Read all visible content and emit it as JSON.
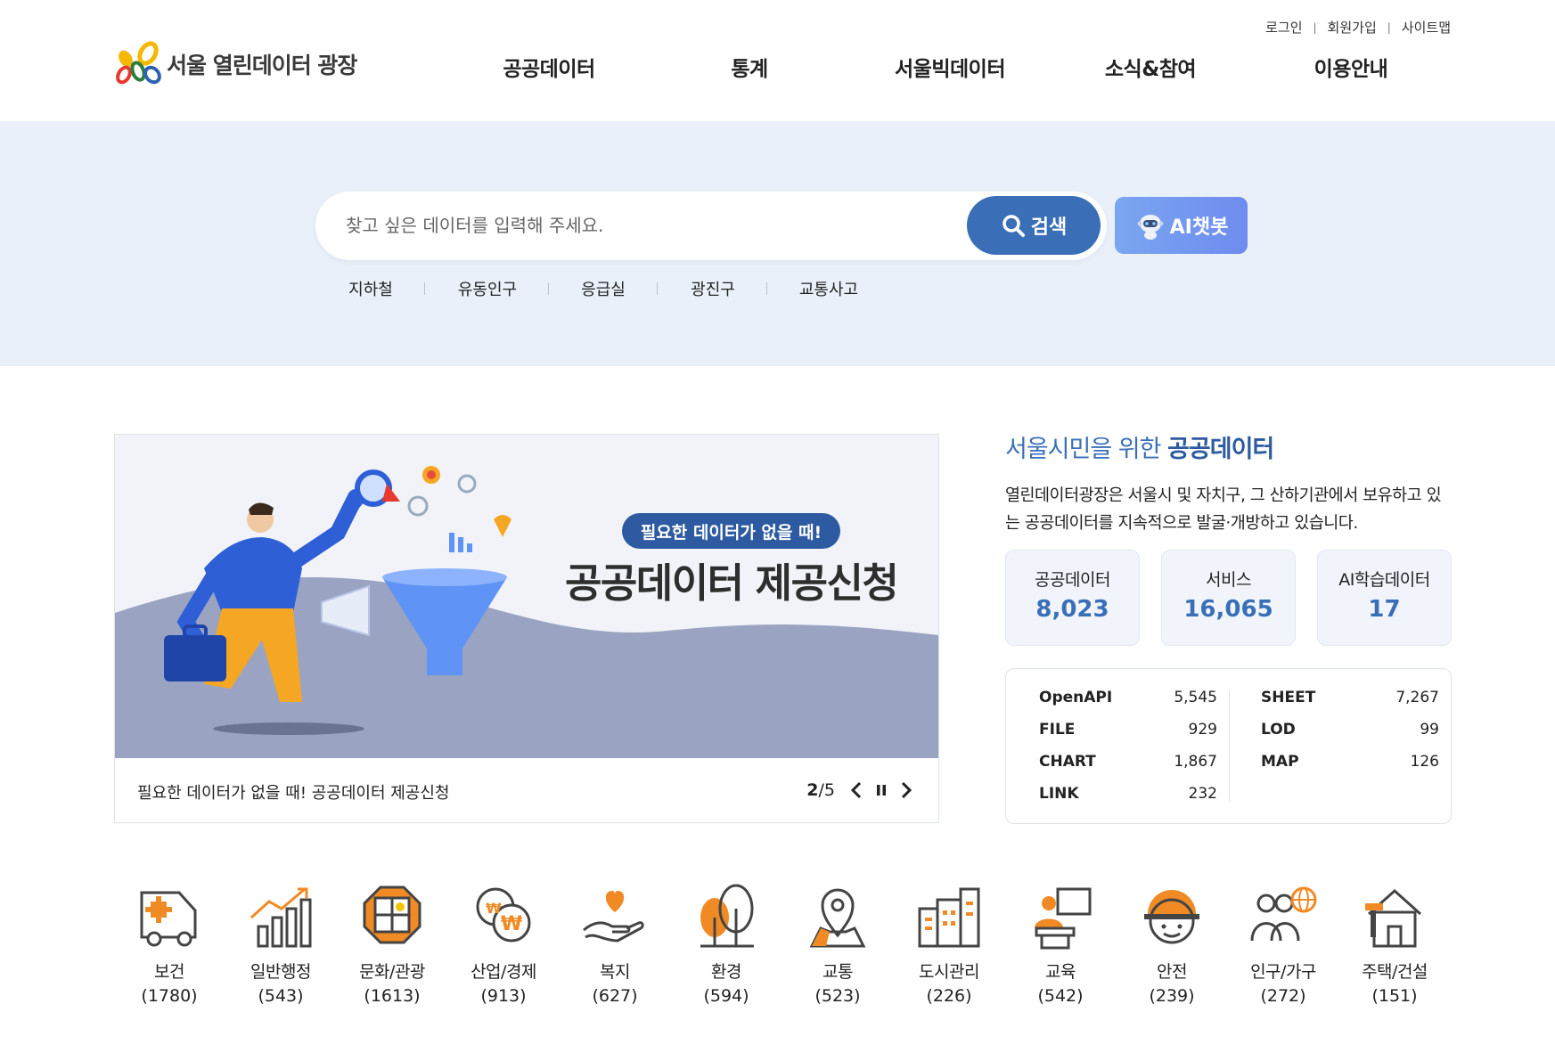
{
  "header": {
    "logo_text": "서울 열린데이터 광장",
    "util_links": [
      "로그인",
      "회원가입",
      "사이트맵"
    ],
    "nav": [
      "공공데이터",
      "통계",
      "서울빅데이터",
      "소식&참여",
      "이용안내"
    ]
  },
  "search": {
    "placeholder": "찾고 싶은 데이터를 입력해 주세요.",
    "button_label": "검색",
    "ai_button_label": "AI챗봇",
    "keywords": [
      "지하철",
      "유동인구",
      "응급실",
      "광진구",
      "교통사고"
    ]
  },
  "banner": {
    "badge": "필요한 데이터가 없을 때!",
    "title": "공공데이터 제공신청",
    "caption": "필요한 데이터가 없을 때! 공공데이터 제공신청",
    "page_current": "2",
    "page_total": "5"
  },
  "info": {
    "title_prefix": "서울시민을 위한 ",
    "title_strong": "공공데이터",
    "description": "열린데이터광장은 서울시 및 자치구, 그 산하기관에서 보유하고 있는 공공데이터를 지속적으로 발굴·개방하고 있습니다.",
    "stats": [
      {
        "label": "공공데이터",
        "value": "8,023"
      },
      {
        "label": "서비스",
        "value": "16,065"
      },
      {
        "label": "AI학습데이터",
        "value": "17"
      }
    ],
    "formats_left": [
      {
        "name": "OpenAPI",
        "value": "5,545"
      },
      {
        "name": "FILE",
        "value": "929"
      },
      {
        "name": "CHART",
        "value": "1,867"
      },
      {
        "name": "LINK",
        "value": "232"
      }
    ],
    "formats_right": [
      {
        "name": "SHEET",
        "value": "7,267"
      },
      {
        "name": "LOD",
        "value": "99"
      },
      {
        "name": "MAP",
        "value": "126"
      }
    ]
  },
  "categories": [
    {
      "name": "보건",
      "count": "(1780)",
      "icon": "ambulance-icon"
    },
    {
      "name": "일반행정",
      "count": "(543)",
      "icon": "bar-chart-icon"
    },
    {
      "name": "문화/관광",
      "count": "(1613)",
      "icon": "window-icon"
    },
    {
      "name": "산업/경제",
      "count": "(913)",
      "icon": "coins-icon"
    },
    {
      "name": "복지",
      "count": "(627)",
      "icon": "heart-hand-icon"
    },
    {
      "name": "환경",
      "count": "(594)",
      "icon": "trees-icon"
    },
    {
      "name": "교통",
      "count": "(523)",
      "icon": "map-pin-icon"
    },
    {
      "name": "도시관리",
      "count": "(226)",
      "icon": "buildings-icon"
    },
    {
      "name": "교육",
      "count": "(542)",
      "icon": "teacher-icon"
    },
    {
      "name": "안전",
      "count": "(239)",
      "icon": "helmet-icon"
    },
    {
      "name": "인구/가구",
      "count": "(272)",
      "icon": "people-globe-icon"
    },
    {
      "name": "주택/건설",
      "count": "(151)",
      "icon": "house-tools-icon"
    }
  ],
  "colors": {
    "accent": "#3a6fb8",
    "accent_dark": "#2d5aa0",
    "band": "#e9f0f9",
    "icon_orange": "#f08a24"
  }
}
